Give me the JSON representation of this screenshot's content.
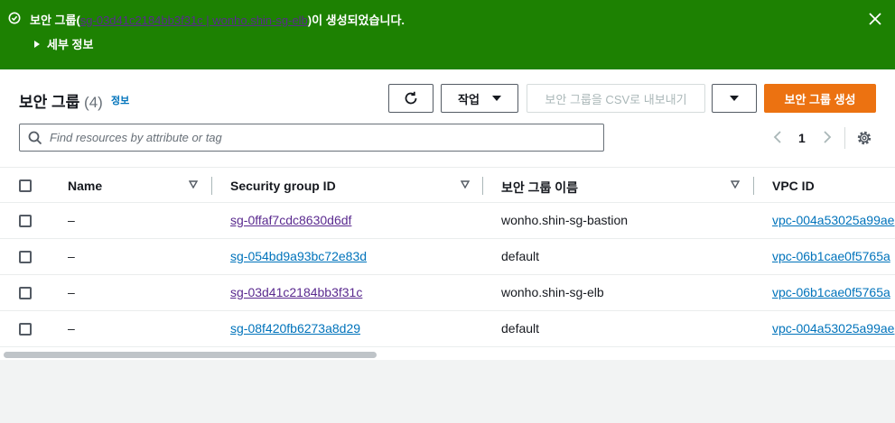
{
  "flash": {
    "prefix": "보안 그룹(",
    "link": "sg-03d41c2184bb3f31c | wonho.shin-sg-elb",
    "suffix": ")이 생성되었습니다.",
    "details": "세부 정보"
  },
  "header": {
    "title": "보안 그룹",
    "count": "(4)",
    "info": "정보"
  },
  "toolbar": {
    "actions_label": "작업",
    "export_label": "보안 그룹을 CSV로 내보내기",
    "create_label": "보안 그룹 생성"
  },
  "search": {
    "placeholder": "Find resources by attribute or tag"
  },
  "pager": {
    "page": "1"
  },
  "columns": {
    "name": "Name",
    "sgid": "Security group ID",
    "sgname": "보안 그룹 이름",
    "vpcid": "VPC ID"
  },
  "rows": [
    {
      "name": "–",
      "sgid": "sg-0ffaf7cdc8630d6df",
      "sgname": "wonho.shin-sg-bastion",
      "vpcid": "vpc-004a53025a99ae"
    },
    {
      "name": "–",
      "sgid": "sg-054bd9a93bc72e83d",
      "sgname": "default",
      "vpcid": "vpc-06b1cae0f5765a"
    },
    {
      "name": "–",
      "sgid": "sg-03d41c2184bb3f31c",
      "sgname": "wonho.shin-sg-elb",
      "vpcid": "vpc-06b1cae0f5765a"
    },
    {
      "name": "–",
      "sgid": "sg-08f420fb6273a8d29",
      "sgname": "default",
      "vpcid": "vpc-004a53025a99ae"
    }
  ],
  "colors": {
    "success": "#1d8102",
    "link": "#0073bb",
    "visited": "#5a2a8f",
    "primary": "#ec7211"
  }
}
